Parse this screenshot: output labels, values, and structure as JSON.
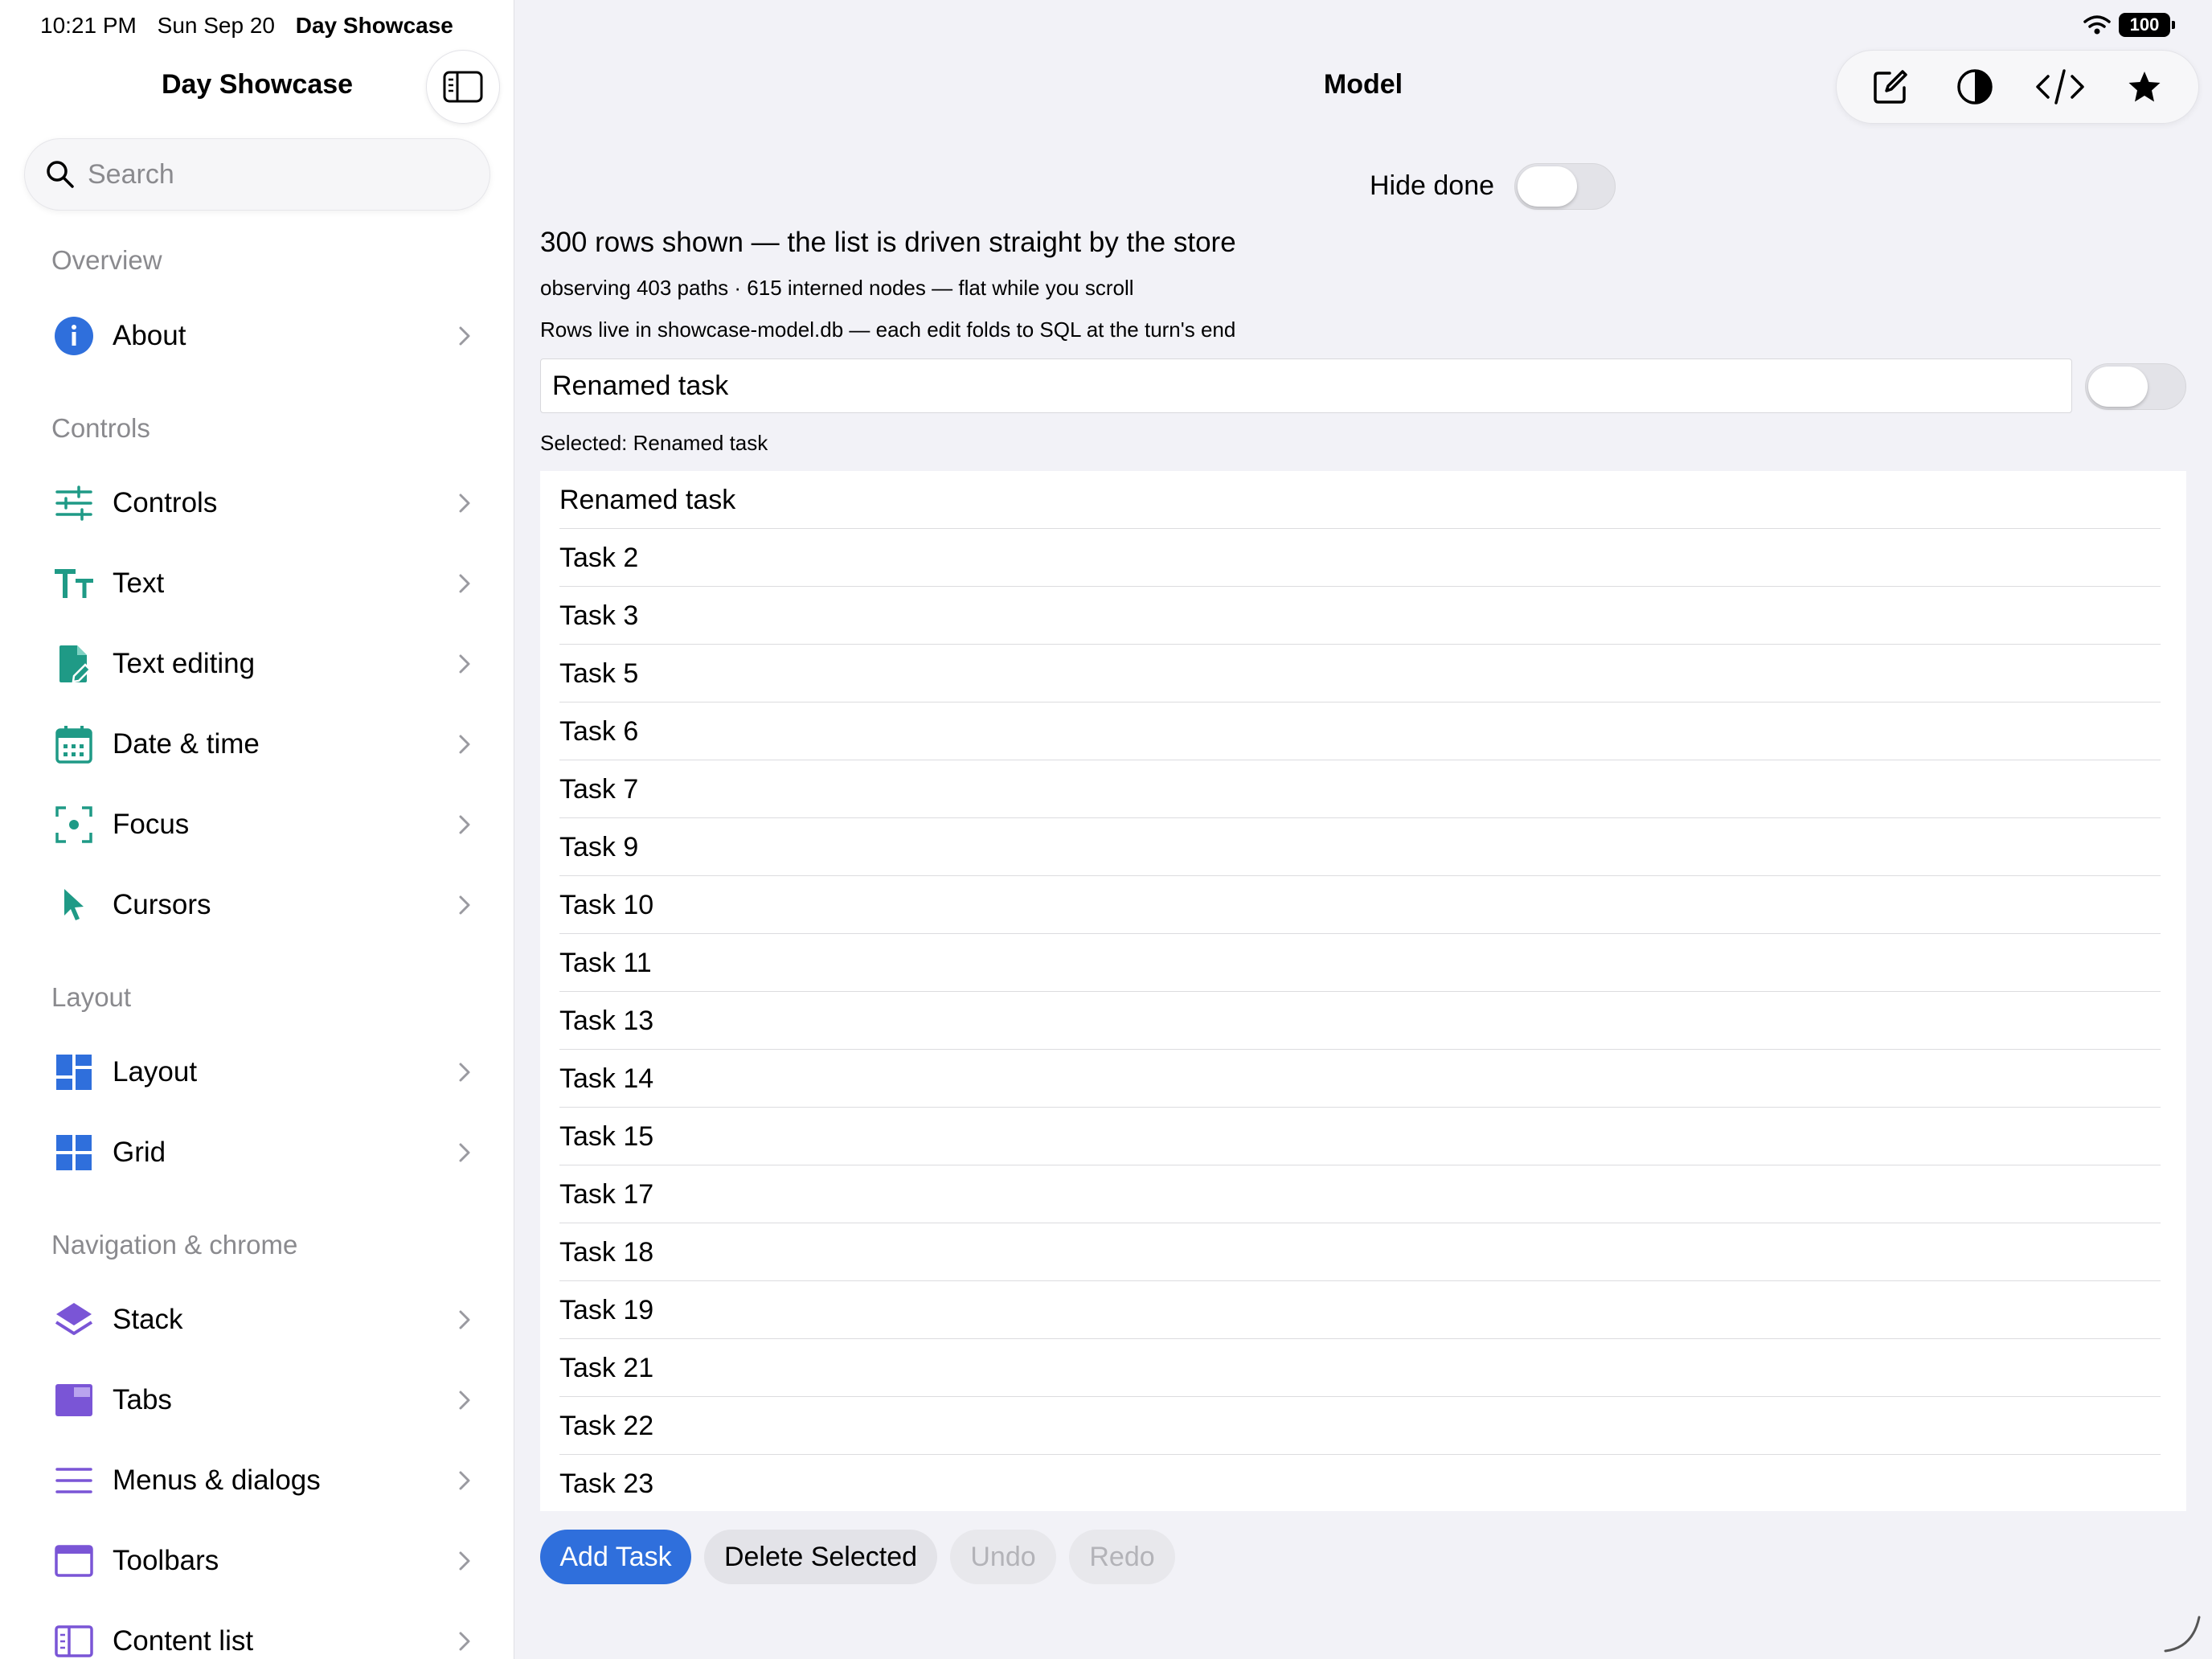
{
  "status_bar": {
    "time": "10:21 PM",
    "date": "Sun Sep 20",
    "app": "Day Showcase",
    "battery": "100",
    "wifi_icon": "wifi-icon"
  },
  "sidebar": {
    "title": "Day Showcase",
    "toggle_icon": "sidebar-toggle-icon",
    "search": {
      "placeholder": "Search",
      "value": ""
    },
    "sections": [
      {
        "header": "Overview",
        "items": [
          {
            "label": "About",
            "icon": "info-icon",
            "color": "#2f6fdc"
          }
        ]
      },
      {
        "header": "Controls",
        "items": [
          {
            "label": "Controls",
            "icon": "sliders-icon",
            "color": "#1f9a86"
          },
          {
            "label": "Text",
            "icon": "text-size-icon",
            "color": "#1f9a86"
          },
          {
            "label": "Text editing",
            "icon": "document-edit-icon",
            "color": "#1f9a86"
          },
          {
            "label": "Date & time",
            "icon": "calendar-icon",
            "color": "#1f9a86"
          },
          {
            "label": "Focus",
            "icon": "focus-icon",
            "color": "#1f9a86"
          },
          {
            "label": "Cursors",
            "icon": "cursor-icon",
            "color": "#1f9a86"
          }
        ]
      },
      {
        "header": "Layout",
        "items": [
          {
            "label": "Layout",
            "icon": "layout-icon",
            "color": "#2f6fdc"
          },
          {
            "label": "Grid",
            "icon": "grid-icon",
            "color": "#2f6fdc"
          }
        ]
      },
      {
        "header": "Navigation & chrome",
        "items": [
          {
            "label": "Stack",
            "icon": "stack-icon",
            "color": "#7a55d6"
          },
          {
            "label": "Tabs",
            "icon": "tabs-icon",
            "color": "#7a55d6"
          },
          {
            "label": "Menus & dialogs",
            "icon": "menu-icon",
            "color": "#7a55d6"
          },
          {
            "label": "Toolbars",
            "icon": "toolbar-icon",
            "color": "#7a55d6"
          },
          {
            "label": "Content list",
            "icon": "content-list-icon",
            "color": "#7a55d6"
          }
        ]
      }
    ]
  },
  "main": {
    "title": "Model",
    "toolbar": {
      "icons": [
        "compose-icon",
        "contrast-icon",
        "code-icon",
        "star-icon"
      ]
    },
    "hide_done": {
      "label": "Hide done",
      "on": false
    },
    "rows_text": "300 rows shown — the list is driven straight by the store",
    "observe_text": "observing 403 paths · 615 interned nodes — flat while you scroll",
    "db_text": "Rows live in showcase-model.db — each edit folds to SQL at the turn's end",
    "task_field": {
      "value": "Renamed task"
    },
    "done_toggle": {
      "on": false
    },
    "selected_text": "Selected: Renamed task",
    "tasks": [
      "Renamed task",
      "Task 2",
      "Task 3",
      "Task 5",
      "Task 6",
      "Task 7",
      "Task 9",
      "Task 10",
      "Task 11",
      "Task 13",
      "Task 14",
      "Task 15",
      "Task 17",
      "Task 18",
      "Task 19",
      "Task 21",
      "Task 22",
      "Task 23"
    ],
    "buttons": {
      "add": "Add Task",
      "delete": "Delete Selected",
      "undo": "Undo",
      "redo": "Redo"
    },
    "colors": {
      "accent": "#2f6fdc"
    }
  }
}
